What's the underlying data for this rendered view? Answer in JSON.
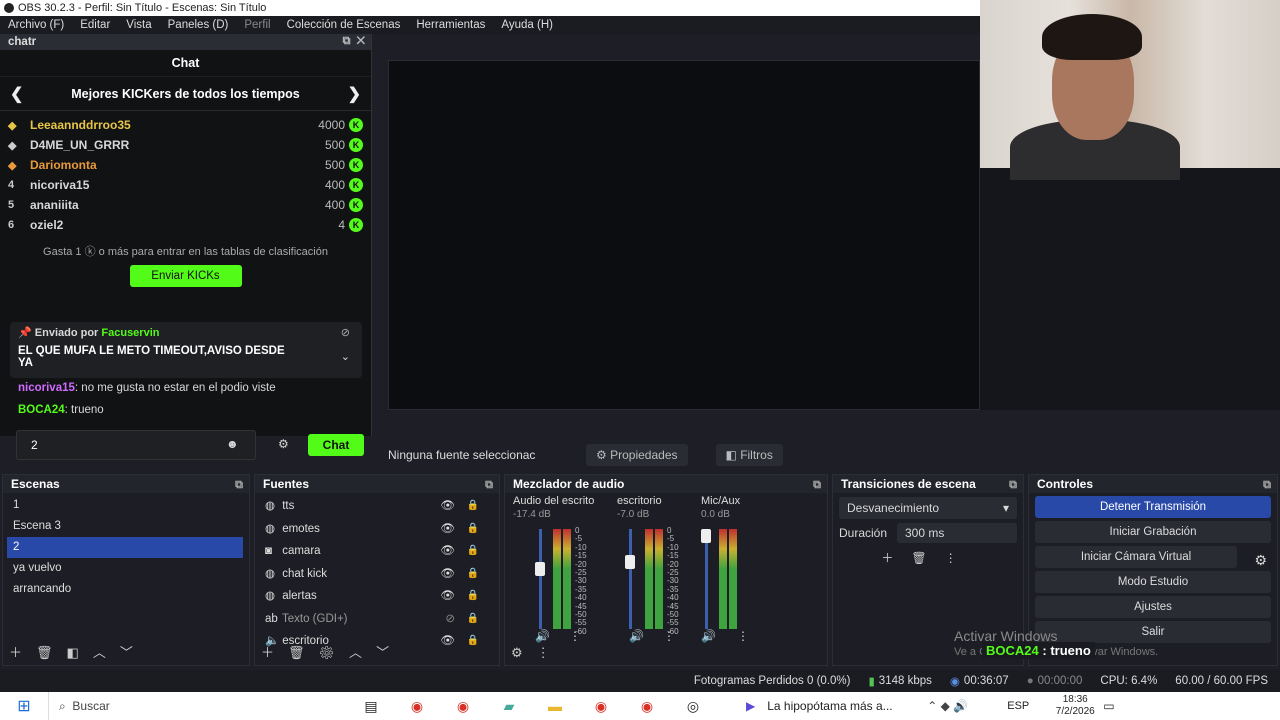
{
  "window": {
    "title": "OBS 30.2.3 - Perfil: Sin Título - Escenas: Sin Título"
  },
  "menu": [
    "Archivo (F)",
    "Editar",
    "Vista",
    "Paneles (D)",
    "Perfil",
    "Colección de Escenas",
    "Herramientas",
    "Ayuda (H)"
  ],
  "chat_dock": {
    "title": "chatr",
    "header": "Chat",
    "leaderboard_title": "Mejores KICKers de todos los tiempos",
    "rows": [
      {
        "rank": "",
        "name": "Leeaannddrroo35",
        "points": "4000",
        "color": "#e8c547"
      },
      {
        "rank": "",
        "name": "D4ME_UN_GRRR",
        "points": "500",
        "color": "#ffffff"
      },
      {
        "rank": "",
        "name": "Dariomonta",
        "points": "500",
        "color": "#e89a3a"
      },
      {
        "rank": "4",
        "name": "nicoriva15",
        "points": "400",
        "color": "#ffffff"
      },
      {
        "rank": "5",
        "name": "ananiiita",
        "points": "400",
        "color": "#ffffff"
      },
      {
        "rank": "6",
        "name": "oziel2",
        "points": "4",
        "color": "#ffffff"
      }
    ],
    "gasta_text": "Gasta 1 ⓚ o más para entrar en las tablas de clasificación",
    "enviar_button": "Enviar KICKs",
    "pinned_by": "Enviado por",
    "pinned_user": "Facuservin",
    "pinned_message": "EL QUE MUFA LE METO TIMEOUT,AVISO DESDE YA",
    "messages": [
      {
        "user": "nicoriva15",
        "user_color": "#d06bff",
        "text": "no me gusta no estar en el podio viste"
      },
      {
        "user": "BOCA24",
        "user_color": "#53fc18",
        "text": "trueno"
      }
    ],
    "input_value": "2",
    "chat_button": "Chat"
  },
  "source_bar": {
    "no_selection": "Ninguna fuente seleccionac",
    "properties": "Propiedades",
    "filters": "Filtros"
  },
  "scenes": {
    "title": "Escenas",
    "items": [
      "1",
      "Escena 3",
      "2",
      "ya vuelvo",
      "arrancando"
    ],
    "selected_index": 2
  },
  "sources": {
    "title": "Fuentes",
    "items": [
      {
        "icon": "globe",
        "name": "tts"
      },
      {
        "icon": "globe",
        "name": "emotes"
      },
      {
        "icon": "camera",
        "name": "camara"
      },
      {
        "icon": "globe",
        "name": "chat kick"
      },
      {
        "icon": "globe",
        "name": "alertas"
      },
      {
        "icon": "text",
        "name": "Texto (GDI+)"
      },
      {
        "icon": "speaker",
        "name": "escritorio"
      }
    ]
  },
  "mixer": {
    "title": "Mezclador de audio",
    "channels": [
      {
        "name": "Audio del escrito",
        "db": "-17.4 dB",
        "level": 0.62
      },
      {
        "name": "escritorio",
        "db": "-7.0 dB",
        "level": 0.7
      },
      {
        "name": "Mic/Aux",
        "db": "0.0 dB",
        "level": 1.0
      }
    ],
    "scale": [
      "0",
      "-5",
      "-10",
      "-15",
      "-20",
      "-25",
      "-30",
      "-35",
      "-40",
      "-45",
      "-50",
      "-55",
      "-60"
    ]
  },
  "transitions": {
    "title": "Transiciones de escena",
    "type": "Desvanecimiento",
    "duration_label": "Duración",
    "duration_value": "300 ms"
  },
  "controls": {
    "title": "Controles",
    "buttons": [
      "Detener Transmisión",
      "Iniciar Grabación",
      "Iniciar Cámara Virtual",
      "Modo Estudio",
      "Ajustes",
      "Salir"
    ]
  },
  "statusbar": {
    "dropped": "Fotogramas Perdidos 0 (0.0%)",
    "bitrate": "3148 kbps",
    "stream_time": "00:36:07",
    "rec_time": "00:00:00",
    "cpu": "CPU: 6.4%",
    "fps": "60.00 / 60.00 FPS"
  },
  "watermark": {
    "line1": "Activar Windows",
    "line2": "Ve a Configuración para activar Windows."
  },
  "overlay": {
    "user": "BOCA24",
    "text": "trueno"
  },
  "taskbar": {
    "search": "Buscar",
    "news": "La hipopótama más a...",
    "lang": "ESP",
    "time": "18:36",
    "date": "7/2/2026"
  }
}
